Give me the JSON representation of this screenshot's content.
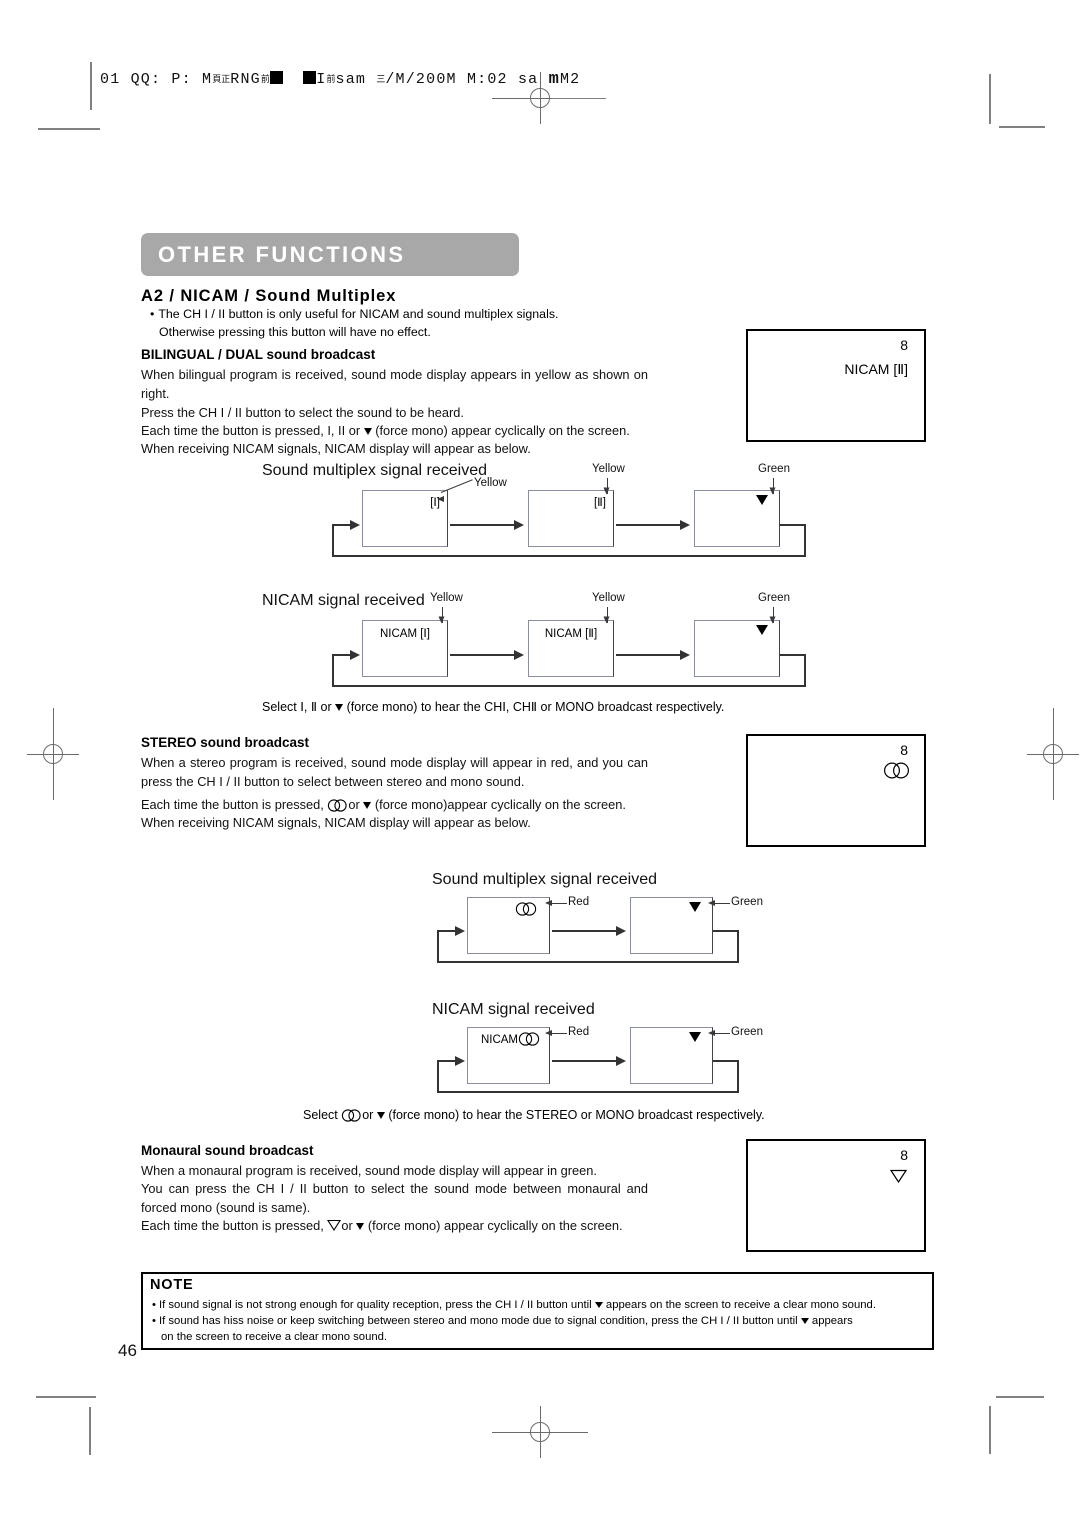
{
  "printer_marks": {
    "job_line_prefix": "01 QQ: P: M",
    "job_line": "01 QQ: P: M頁RNG頁   頁sam  /M/200M  M:02 sa m M2"
  },
  "header": {
    "job_parts": {
      "p1": "01 QQ: P: M",
      "sub1": "頁",
      "sub2": "正",
      "p2": "RNG",
      "sub3": "前",
      "p3": "I",
      "sub4": "前",
      "p4": "sam",
      "sub5": "三",
      "p5": "/M/200M  M:02 ",
      "p6": "sa ",
      "p7": "m",
      "p8": "M2"
    }
  },
  "section": {
    "banner_title": "OTHER FUNCTIONS",
    "heading": "A2 / NICAM / Sound Multiplex",
    "intro_bullet_line1": "The CH I / II button is only useful for NICAM and sound multiplex signals.",
    "intro_bullet_line2": "Otherwise pressing this button will have no effect."
  },
  "bilingual": {
    "title": "BILINGUAL / DUAL sound broadcast",
    "p1": "When bilingual program is received, sound mode display appears in yellow as shown on right.",
    "p2": "Press the CH I / II button to select the sound to be heard.",
    "p3_a": "Each time the button is pressed, I, II or",
    "p3_b": "(force mono) appear cyclically on the screen.",
    "p4": "When receiving NICAM signals, NICAM display will appear as below.",
    "tv_channel": "8",
    "tv_mode": "NICAM [Ⅱ]"
  },
  "flow_multiplex_bilingual": {
    "title": "Sound multiplex signal received",
    "boxes": [
      {
        "label": "[Ⅰ]",
        "caller": "Yellow"
      },
      {
        "label": "[Ⅱ]",
        "caller": "Yellow"
      },
      {
        "label": "",
        "caller": "Green",
        "icon": "down-triangle"
      }
    ]
  },
  "flow_nicam_bilingual": {
    "title": "NICAM signal received",
    "boxes": [
      {
        "label": "NICAM [Ⅰ]",
        "caller": "Yellow"
      },
      {
        "label": "NICAM [Ⅱ]",
        "caller": "Yellow"
      },
      {
        "label": "",
        "caller": "Green",
        "icon": "down-triangle"
      }
    ]
  },
  "bilingual_caption": {
    "a": "Select",
    "b": "Ⅰ,",
    "c": "Ⅱ or",
    "d": "(force mono) to hear the CH",
    "e": "Ⅰ, CH",
    "f": "Ⅱ or MONO broadcast respectively."
  },
  "stereo": {
    "title": "STEREO sound broadcast",
    "p1": "When a stereo program is received, sound mode display will appear in red, and you can press the CH I / II button to select between stereo and mono sound.",
    "p2_a": "Each time the button is pressed,",
    "p2_b": "or",
    "p2_c": "(force mono)appear cyclically on the screen.",
    "p3": "When receiving NICAM signals, NICAM display will appear as below.",
    "tv_channel": "8",
    "tv_mode_icon": "stereo-circles"
  },
  "flow_multiplex_stereo": {
    "title": "Sound multiplex signal received",
    "boxes": [
      {
        "label": "",
        "icon": "stereo-circles",
        "caller": "Red"
      },
      {
        "label": "",
        "icon": "down-triangle",
        "caller": "Green"
      }
    ]
  },
  "flow_nicam_stereo": {
    "title": "NICAM signal received",
    "boxes": [
      {
        "label": "NICAM",
        "icon": "stereo-circles",
        "caller": "Red"
      },
      {
        "label": "",
        "icon": "down-triangle",
        "caller": "Green"
      }
    ]
  },
  "stereo_caption": {
    "a": "Select",
    "b": "or",
    "c": "(force mono) to hear the STEREO or MONO broadcast respectively."
  },
  "monaural": {
    "title": "Monaural sound broadcast",
    "p1": "When a monaural program is received, sound mode display will appear in green.",
    "p2": "You can press the CH I / II button to select the sound mode between monaural and forced mono (sound is same).",
    "p3_a": "Each time the button is pressed,",
    "p3_b": "or",
    "p3_c": "(force mono) appear cyclically on the screen.",
    "tv_channel": "8",
    "tv_mode_icon": "open-down-triangle"
  },
  "note": {
    "title": "NOTE",
    "line1_a": "If sound signal is not strong enough for quality reception, press the CH I / II button until",
    "line1_b": "appears on the screen to receive a clear mono sound.",
    "line2_a": "If sound has hiss noise or keep switching between stereo and mono mode due to signal condition, press the CH I / II button until",
    "line2_b": "appears",
    "line3": "on the screen to receive a clear mono sound."
  },
  "page_number": "46",
  "colors": {
    "banner_bg": "#a8a8a8",
    "banner_text": "#ffffff",
    "line": "#333333",
    "mark": "#808080"
  }
}
